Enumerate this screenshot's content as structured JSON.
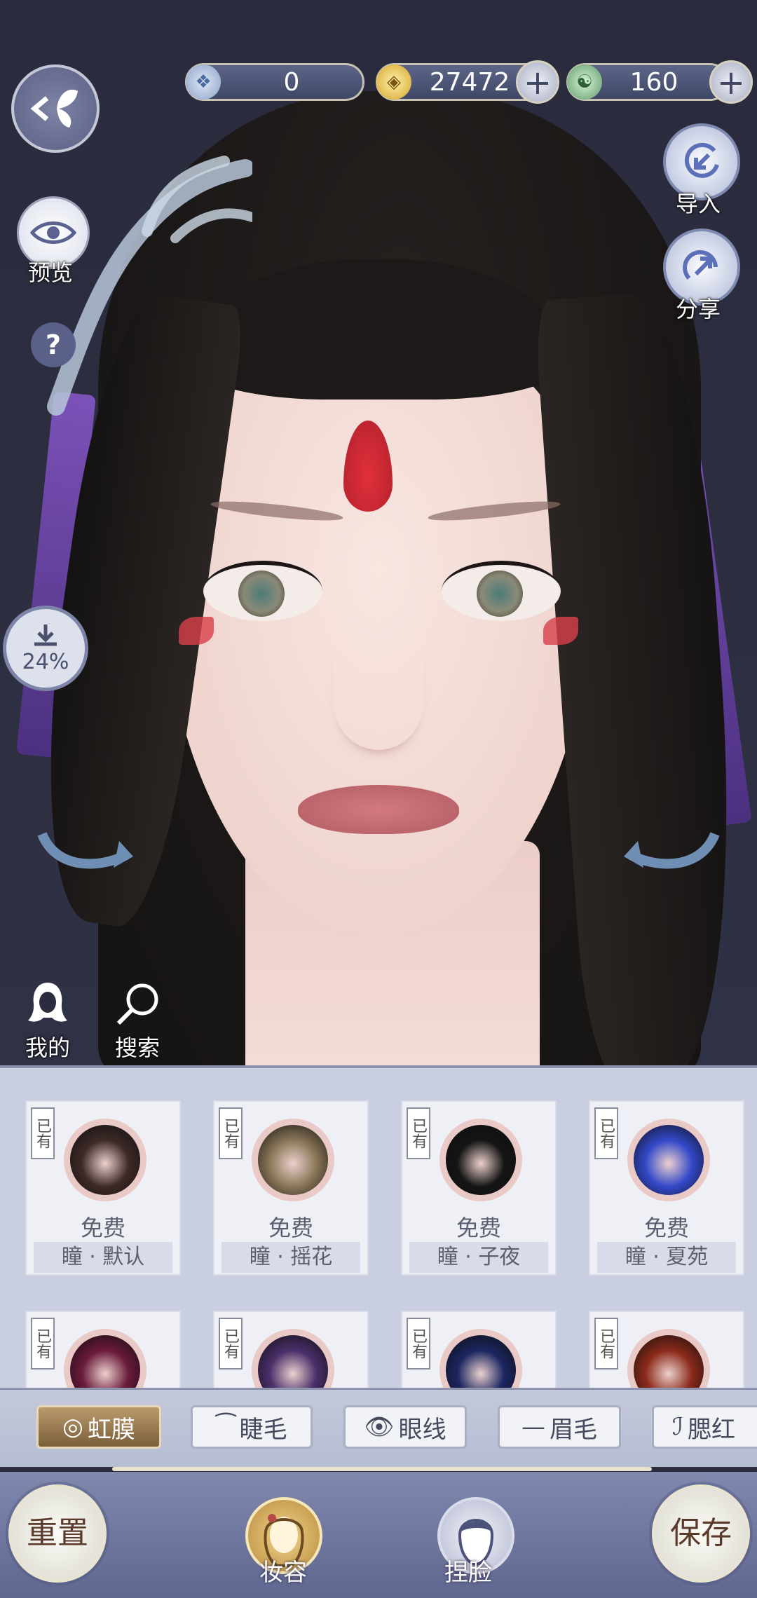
{
  "top_bar": {
    "currency1_value": "0",
    "currency2_value": "27472",
    "currency3_value": "160",
    "plus": "+"
  },
  "left_tools": {
    "preview_label": "预览",
    "help_label": "?",
    "download_progress": "24%"
  },
  "right_tools": {
    "import_label": "导入",
    "share_label": "分享"
  },
  "quick": {
    "mine_label": "我的",
    "search_label": "搜索"
  },
  "cards": [
    {
      "owned": "已有",
      "price": "免费",
      "name": "瞳 · 默认",
      "color": "#3d2a28"
    },
    {
      "owned": "已有",
      "price": "免费",
      "name": "瞳 · 摇花",
      "color": "#8a7658"
    },
    {
      "owned": "已有",
      "price": "免费",
      "name": "瞳 · 子夜",
      "color": "#151515"
    },
    {
      "owned": "已有",
      "price": "免费",
      "name": "瞳 · 夏苑",
      "color": "#3348c8"
    },
    {
      "owned": "已有",
      "price": "",
      "name": "",
      "color": "#6a1a3a"
    },
    {
      "owned": "已有",
      "price": "",
      "name": "",
      "color": "#4a2f6a"
    },
    {
      "owned": "已有",
      "price": "",
      "name": "",
      "color": "#1c2660"
    },
    {
      "owned": "已有",
      "price": "",
      "name": "",
      "color": "#8a2a1a"
    }
  ],
  "tabs": [
    {
      "icon": "◎",
      "label": "虹膜"
    },
    {
      "icon": "⁀",
      "label": "睫毛"
    },
    {
      "icon": "👁",
      "label": "眼线"
    },
    {
      "icon": "—",
      "label": "眉毛"
    },
    {
      "icon": "ℐ",
      "label": "腮红"
    }
  ],
  "bottom": {
    "reset_label": "重置",
    "makeup_label": "妆容",
    "face_label": "捏脸",
    "save_label": "保存"
  }
}
